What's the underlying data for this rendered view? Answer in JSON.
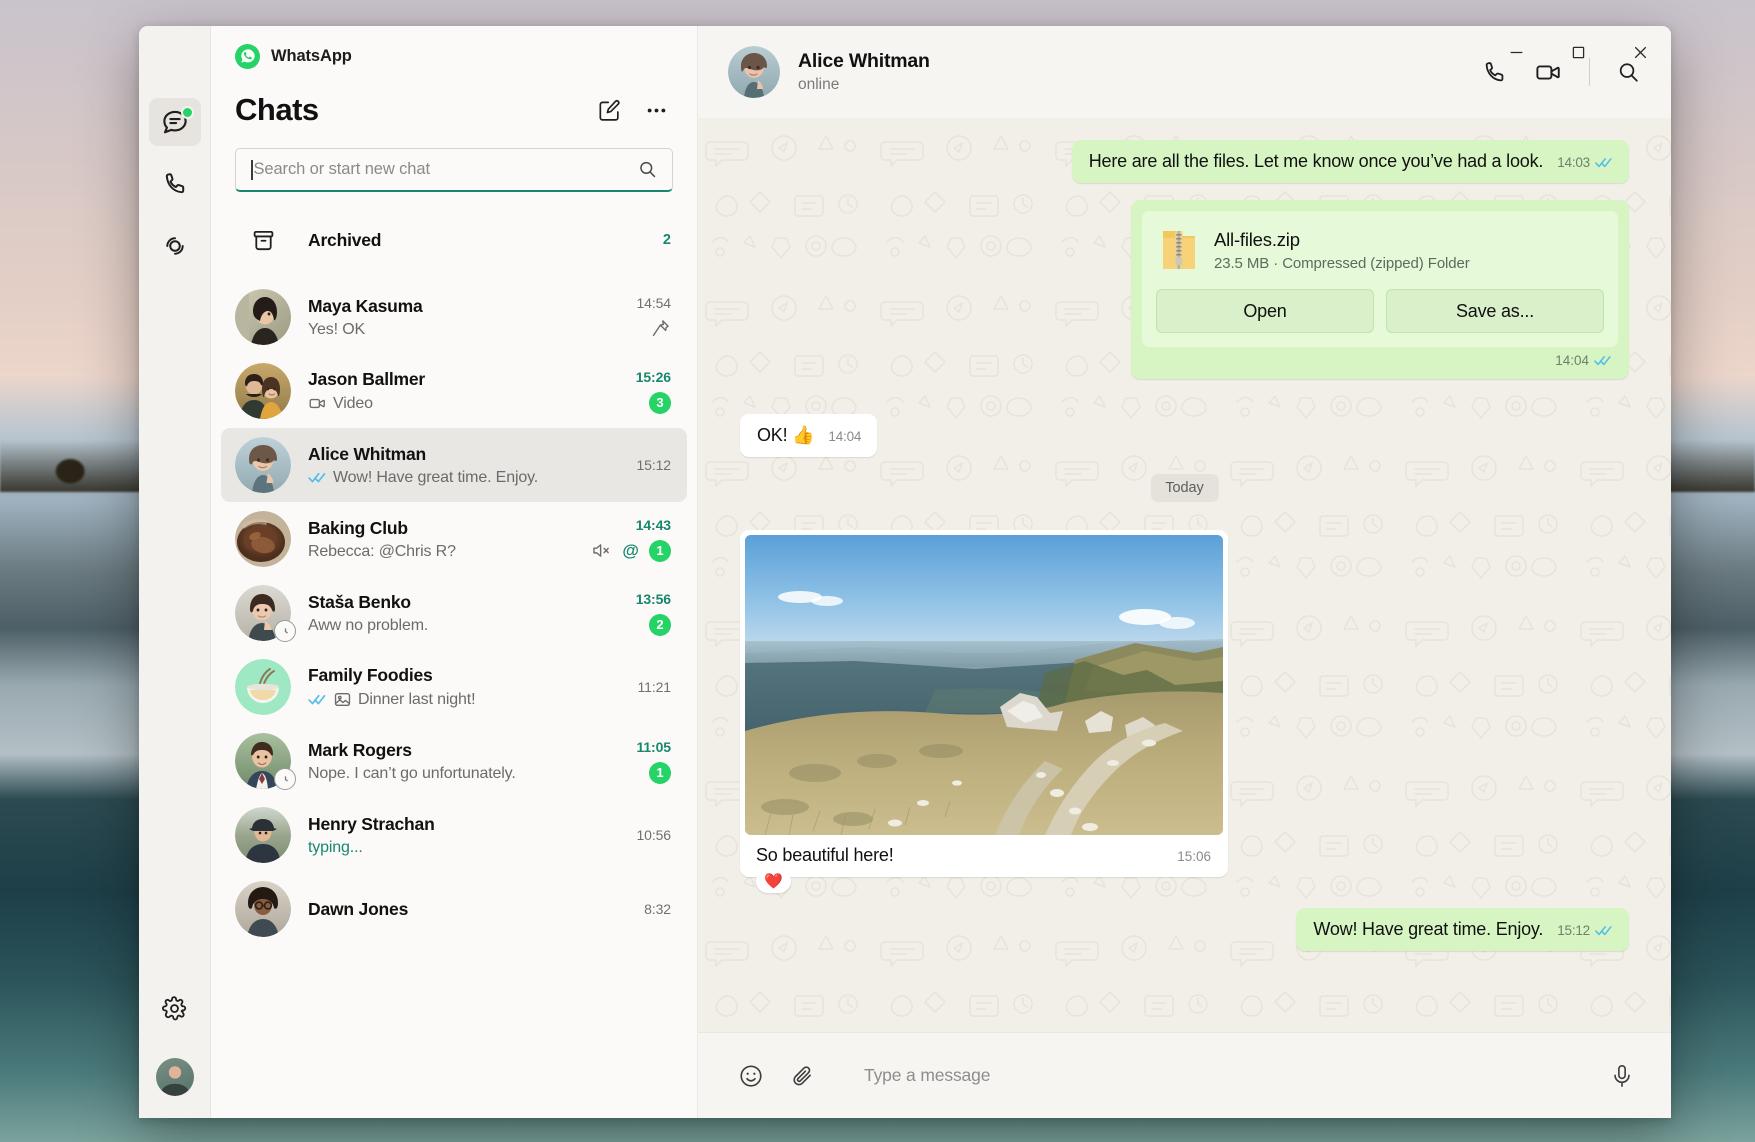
{
  "app": {
    "brand_name": "WhatsApp",
    "logo_icon": "whatsapp-logo-icon"
  },
  "window_controls": {
    "minimize": "minimize-icon",
    "maximize": "maximize-icon",
    "close": "close-icon"
  },
  "rail": {
    "items": [
      {
        "name": "chats",
        "icon": "chats-icon",
        "active": true,
        "has_dot": true
      },
      {
        "name": "calls",
        "icon": "phone-icon",
        "active": false,
        "has_dot": false
      },
      {
        "name": "status",
        "icon": "status-circle-icon",
        "active": false,
        "has_dot": false
      }
    ],
    "settings_icon": "gear-icon",
    "profile_avatar": "profile-avatar"
  },
  "list": {
    "title": "Chats",
    "new_chat_icon": "compose-icon",
    "more_icon": "more-options-icon",
    "search": {
      "placeholder": "Search or start new chat",
      "value": "",
      "icon": "search-icon"
    },
    "archived": {
      "label": "Archived",
      "count": "2",
      "icon": "archive-icon"
    },
    "rows": [
      {
        "name": "Maya Kasuma",
        "preview": "Yes! OK",
        "time": "14:54",
        "time_green": false,
        "badge": "",
        "pinned": true,
        "muted": false,
        "mention": false,
        "ticks": "",
        "selected": false,
        "typing": false,
        "avatar_kind": "photo-maya",
        "status_ring": false,
        "media_icon": ""
      },
      {
        "name": "Jason Ballmer",
        "preview": "Video",
        "time": "15:26",
        "time_green": true,
        "badge": "3",
        "pinned": false,
        "muted": false,
        "mention": false,
        "ticks": "",
        "selected": false,
        "typing": false,
        "avatar_kind": "photo-jason",
        "status_ring": false,
        "media_icon": "video-icon"
      },
      {
        "name": "Alice Whitman",
        "preview": "Wow! Have great time. Enjoy.",
        "time": "15:12",
        "time_green": false,
        "badge": "",
        "pinned": false,
        "muted": false,
        "mention": false,
        "ticks": "read",
        "selected": true,
        "typing": false,
        "avatar_kind": "photo-alice",
        "status_ring": false,
        "media_icon": ""
      },
      {
        "name": "Baking Club",
        "preview": "Rebecca: @Chris R?",
        "time": "14:43",
        "time_green": true,
        "badge": "1",
        "pinned": false,
        "muted": true,
        "mention": true,
        "ticks": "",
        "selected": false,
        "typing": false,
        "avatar_kind": "photo-baking",
        "status_ring": false,
        "media_icon": ""
      },
      {
        "name": "Staša Benko",
        "preview": "Aww no problem.",
        "time": "13:56",
        "time_green": true,
        "badge": "2",
        "pinned": false,
        "muted": false,
        "mention": false,
        "ticks": "",
        "selected": false,
        "typing": false,
        "avatar_kind": "photo-stasa",
        "status_ring": true,
        "media_icon": ""
      },
      {
        "name": "Family Foodies",
        "preview": "Dinner last night!",
        "time": "11:21",
        "time_green": false,
        "badge": "",
        "pinned": false,
        "muted": false,
        "mention": false,
        "ticks": "read",
        "selected": false,
        "typing": false,
        "avatar_kind": "group-noodles",
        "status_ring": false,
        "media_icon": "image-icon"
      },
      {
        "name": "Mark Rogers",
        "preview": "Nope. I can’t go unfortunately.",
        "time": "11:05",
        "time_green": true,
        "badge": "1",
        "pinned": false,
        "muted": false,
        "mention": false,
        "ticks": "",
        "selected": false,
        "typing": false,
        "avatar_kind": "photo-mark",
        "status_ring": true,
        "media_icon": ""
      },
      {
        "name": "Henry Strachan",
        "preview": "typing...",
        "time": "10:56",
        "time_green": false,
        "badge": "",
        "pinned": false,
        "muted": false,
        "mention": false,
        "ticks": "",
        "selected": false,
        "typing": true,
        "avatar_kind": "photo-henry",
        "status_ring": false,
        "media_icon": ""
      },
      {
        "name": "Dawn Jones",
        "preview": "",
        "time": "8:32",
        "time_green": false,
        "badge": "",
        "pinned": false,
        "muted": false,
        "mention": false,
        "ticks": "",
        "selected": false,
        "typing": false,
        "avatar_kind": "photo-dawn",
        "status_ring": false,
        "media_icon": ""
      }
    ]
  },
  "conversation": {
    "contact_name": "Alice Whitman",
    "contact_status": "online",
    "voice_call_icon": "phone-icon",
    "video_call_icon": "video-camera-icon",
    "search_icon": "search-icon",
    "day_divider": "Today",
    "messages": [
      {
        "id": "m1",
        "dir": "out",
        "type": "text",
        "text": "Here are all the files. Let me know once you’ve had a look.",
        "time": "14:03",
        "ticks": "read"
      },
      {
        "id": "m2",
        "dir": "out",
        "type": "file",
        "file_name": "All-files.zip",
        "file_meta": "23.5 MB · Compressed (zipped) Folder",
        "open_label": "Open",
        "save_label": "Save as...",
        "time": "14:04",
        "ticks": "read",
        "file_icon": "zip-folder-icon"
      },
      {
        "id": "m3",
        "dir": "in",
        "type": "text",
        "text": "OK! 👍",
        "time": "14:04",
        "ticks": ""
      },
      {
        "id": "m4",
        "dir": "in",
        "type": "image",
        "caption": "So beautiful here!",
        "time": "15:06",
        "ticks": "",
        "reaction": "❤️",
        "image_alt": "mountain-ridge-photo"
      },
      {
        "id": "m5",
        "dir": "out",
        "type": "text",
        "text": "Wow! Have great time. Enjoy.",
        "time": "15:12",
        "ticks": "read"
      }
    ]
  },
  "composer": {
    "emoji_icon": "emoji-icon",
    "attach_icon": "paperclip-icon",
    "placeholder": "Type a message",
    "mic_icon": "microphone-icon"
  },
  "colors": {
    "brand_green": "#25d366",
    "accent_green": "#17876d",
    "out_bubble": "#d6f5c3",
    "in_bubble": "#ffffff",
    "tick_blue": "#53bdeb"
  }
}
